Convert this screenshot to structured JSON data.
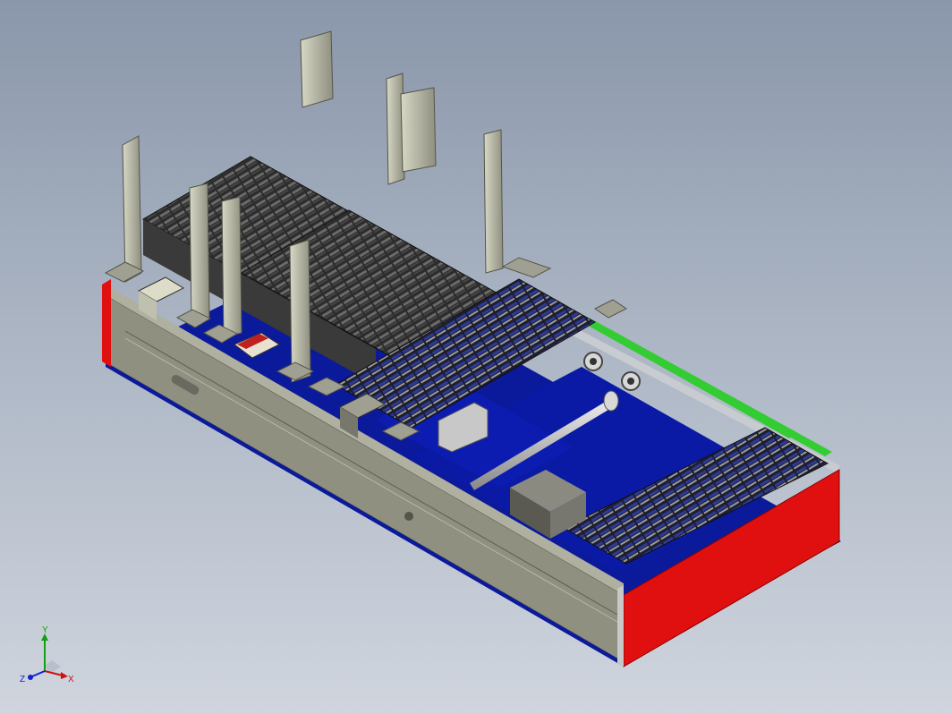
{
  "viewport": {
    "background_top": "#8a97aa",
    "background_bottom": "#d0d5de"
  },
  "model": {
    "frame_color": "#8f9080",
    "end_plate_color": "#e01010",
    "base_plate_color": "#0a1a9a",
    "belt_color": "#33cc33",
    "tray_color": "#3a3a3a",
    "motor_color": "#6e6e66"
  },
  "triad": {
    "x_label": "X",
    "y_label": "Y",
    "z_label": "Z",
    "x_color": "#d01010",
    "y_color": "#10a010",
    "z_color": "#1020d0"
  }
}
